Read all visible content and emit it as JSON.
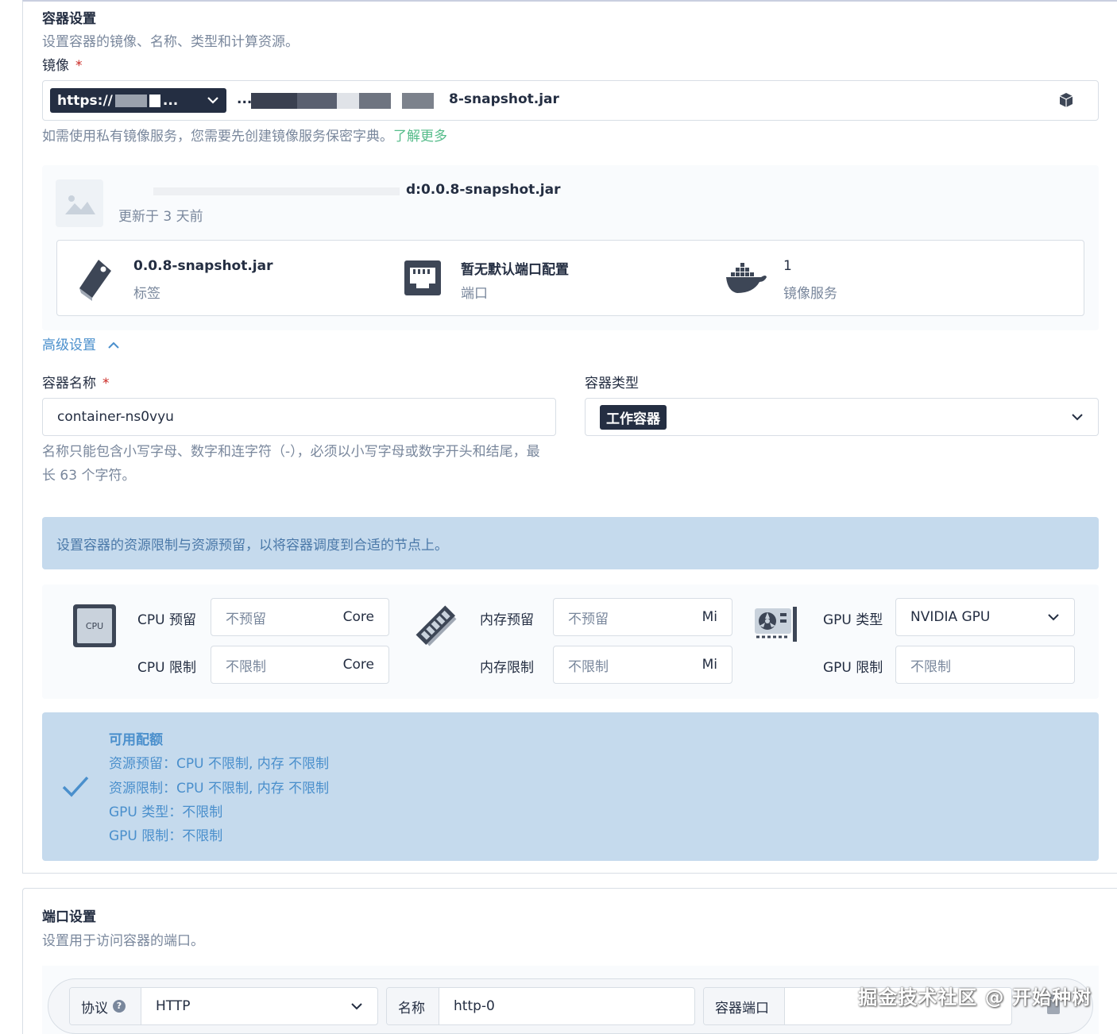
{
  "container_settings": {
    "title": "容器设置",
    "description": "设置容器的镜像、名称、类型和计算资源。",
    "image_label": "镜像",
    "required_mark": "*",
    "registry_button": "https://",
    "registry_ellipsis": "...",
    "image_value_fragment_a": "...",
    "image_value_fragment_b": "8-snapshot.jar",
    "private_hint": "如需使用私有镜像服务，您需要先创建镜像服务保密字典。",
    "learn_more": "了解更多"
  },
  "image_detail": {
    "name": "d:0.0.8-snapshot.jar",
    "updated": "更新于 3 天前",
    "tag_value": "0.0.8-snapshot.jar",
    "tag_label": "标签",
    "port_value": "暂无默认端口配置",
    "port_label": "端口",
    "registry_value": "1",
    "registry_label": "镜像服务"
  },
  "advanced": {
    "label": "高级设置"
  },
  "container_name": {
    "label": "容器名称",
    "value": "container-ns0vyu",
    "hint": "名称只能包含小写字母、数字和连字符（-），必须以小写字母或数字开头和结尾，最长 63 个字符。"
  },
  "container_type": {
    "label": "容器类型",
    "value": "工作容器"
  },
  "resource_banner": "设置容器的资源限制与资源预留，以将容器调度到合适的节点上。",
  "resources": {
    "cpu_icon_text": "CPU",
    "cpu_reserve_label": "CPU 预留",
    "cpu_reserve_placeholder": "不预留",
    "cpu_limit_label": "CPU 限制",
    "cpu_limit_placeholder": "不限制",
    "cpu_unit": "Core",
    "mem_reserve_label": "内存预留",
    "mem_reserve_placeholder": "不预留",
    "mem_limit_label": "内存限制",
    "mem_limit_placeholder": "不限制",
    "mem_unit": "Mi",
    "gpu_type_label": "GPU 类型",
    "gpu_type_value": "NVIDIA GPU",
    "gpu_limit_label": "GPU 限制",
    "gpu_limit_placeholder": "不限制"
  },
  "quota": {
    "title": "可用配额",
    "line1": "资源预留：CPU 不限制, 内存 不限制",
    "line2": "资源限制：CPU 不限制, 内存 不限制",
    "line3": "GPU 类型：不限制",
    "line4": "GPU 限制：不限制"
  },
  "port_settings": {
    "title": "端口设置",
    "description": "设置用于访问容器的端口。",
    "protocol_label": "协议",
    "protocol_help": "?",
    "protocol_value": "HTTP",
    "name_label": "名称",
    "name_value": "http-0",
    "container_port_label": "容器端口"
  },
  "watermark": "掘金技术社区 @ 开始种树",
  "colors": {
    "primary_dark": "#242e42",
    "muted": "#79879c",
    "link_green": "#55bc8a",
    "info_blue_bg": "#c5daed",
    "info_blue_text": "#4a8fcc",
    "required_red": "#ca2621"
  }
}
